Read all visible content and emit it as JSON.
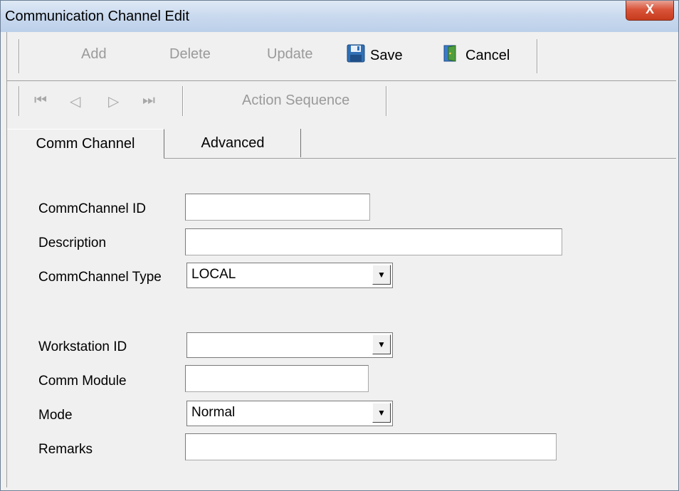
{
  "window": {
    "title": "Communication Channel Edit",
    "close_glyph": "X"
  },
  "toolbar": {
    "add_label": "Add",
    "delete_label": "Delete",
    "update_label": "Update",
    "save_label": "Save",
    "cancel_label": "Cancel",
    "action_sequence_label": "Action Sequence",
    "nav_first": "⏮",
    "nav_prev": "◁",
    "nav_next": "▷",
    "nav_last": "⏭"
  },
  "tabs": [
    {
      "label": "Comm Channel",
      "active": true
    },
    {
      "label": "Advanced",
      "active": false
    }
  ],
  "form": {
    "commchannel_id": {
      "label": "CommChannel ID",
      "value": ""
    },
    "description": {
      "label": "Description",
      "value": ""
    },
    "commchannel_type": {
      "label": "CommChannel Type",
      "value": "LOCAL"
    },
    "workstation_id": {
      "label": "Workstation ID",
      "value": ""
    },
    "comm_module": {
      "label": "Comm Module",
      "value": ""
    },
    "mode": {
      "label": "Mode",
      "value": "Normal"
    },
    "remarks": {
      "label": "Remarks",
      "value": ""
    }
  },
  "icons": {
    "save": "floppy-disk-icon",
    "cancel": "door-exit-icon",
    "dropdown": "▼"
  },
  "colors": {
    "title_bar": "#c9d9ee",
    "close_button": "#d9553a",
    "background": "#f0f0f0",
    "disabled_text": "#9a9a9a"
  }
}
